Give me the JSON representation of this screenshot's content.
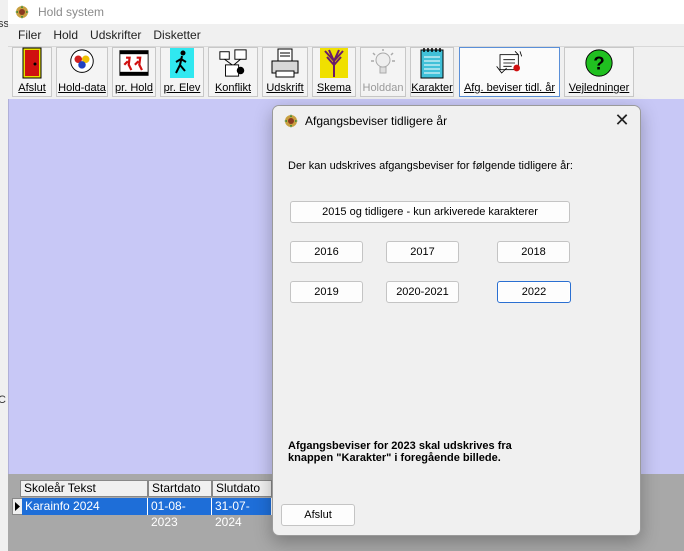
{
  "window": {
    "title": "Hold system"
  },
  "menu": {
    "items": [
      "Filer",
      "Hold",
      "Udskrifter",
      "Disketter"
    ]
  },
  "toolbar": {
    "buttons": [
      {
        "label": "Afslut",
        "icon": "exit-door-icon"
      },
      {
        "label": "Hold-data",
        "icon": "hold-data-icon"
      },
      {
        "label": "pr. Hold",
        "icon": "film-strip-icon"
      },
      {
        "label": "pr. Elev",
        "icon": "walking-person-icon"
      },
      {
        "label": "Konflikt",
        "icon": "conflict-diagram-icon"
      },
      {
        "label": "Udskrift",
        "icon": "printer-icon"
      },
      {
        "label": "Skema",
        "icon": "schedule-icon"
      },
      {
        "label": "Holddan",
        "icon": "lightbulb-icon"
      },
      {
        "label": "Karakter",
        "icon": "notepad-icon"
      },
      {
        "label": "Afg. beviser tidl. år",
        "icon": "certificate-icon"
      },
      {
        "label": "Vejledninger",
        "icon": "question-mark-icon"
      }
    ]
  },
  "grid": {
    "headers": [
      "Skoleår Tekst",
      "Startdato",
      "Slutdato"
    ],
    "row": [
      "Karainfo 2024",
      "01-08-2023",
      "31-07-2024"
    ]
  },
  "dialog": {
    "title": "Afgangsbeviser tidligere år",
    "intro": "Der kan udskrives afgangsbeviser for følgende tidligere år:",
    "archive_button": "2015 og tidligere - kun arkiverede karakterer",
    "year_buttons": [
      "2016",
      "2017",
      "2018",
      "2019",
      "2020-2021",
      "2022"
    ],
    "note": "Afgangsbeviser for 2023 skal udskrives fra knappen \"Karakter\" i foregående billede.",
    "close_button": "Afslut"
  },
  "left_edge": {
    "fragments": [
      "ss",
      "C"
    ]
  },
  "colors": {
    "workspace": "#c8c8f6",
    "selection": "#1e6ed8",
    "focus": "#2a6fd1"
  }
}
